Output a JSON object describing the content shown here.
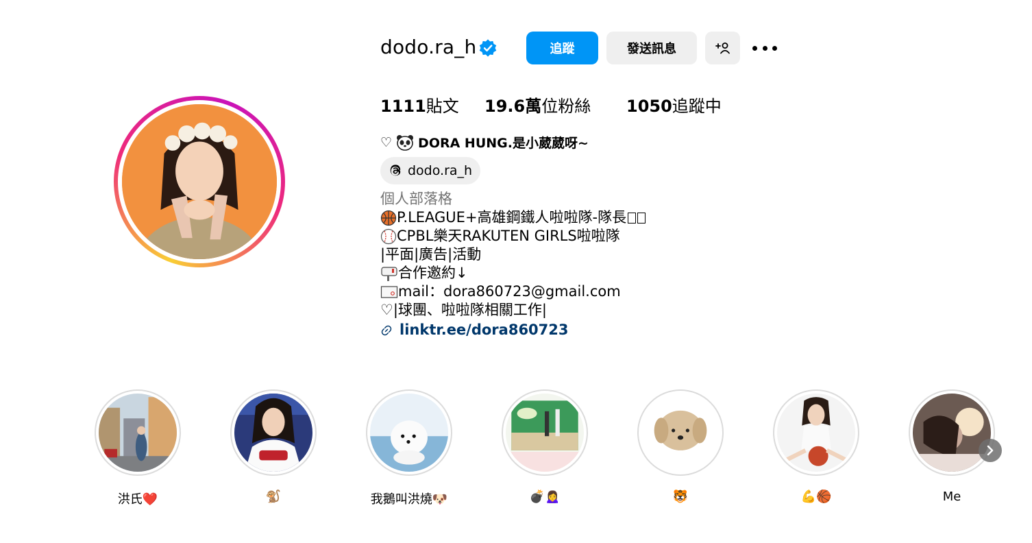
{
  "profile": {
    "username": "dodo.ra_h",
    "follow_label": "追蹤",
    "message_label": "發送訊息",
    "stats": {
      "posts_count": "1111",
      "posts_label": "貼文",
      "followers_count": "19.6萬",
      "followers_label": "位粉絲",
      "following_count": "1050",
      "following_label": "追蹤中"
    },
    "full_name": "DORA HUNG.是小葳葳呀~",
    "full_name_prefix": "♡",
    "threads_handle": "dodo.ra_h",
    "category": "個人部落格",
    "bio_lines": [
      "P.LEAGUE+高雄鋼鐵人啦啦隊-隊長",
      "CPBL樂天RAKUTEN GIRLS啦啦隊",
      "|平面|廣告|活動",
      "合作邀約↓",
      "mail：dora860723@gmail.com",
      "♡|球團、啦啦隊相關工作|"
    ],
    "link": "linktr.ee/dora860723"
  },
  "highlights": [
    {
      "label": "洪氏❤️"
    },
    {
      "label": "🐒"
    },
    {
      "label": "我鵝叫洪燒🐶"
    },
    {
      "label": "💣🙍‍♀️"
    },
    {
      "label": "🐯"
    },
    {
      "label": "💪🏀"
    },
    {
      "label": "Me"
    }
  ],
  "colors": {
    "accent": "#0095f6",
    "link": "#00376b",
    "secondary_button": "#efefef",
    "muted_text": "#737373"
  }
}
